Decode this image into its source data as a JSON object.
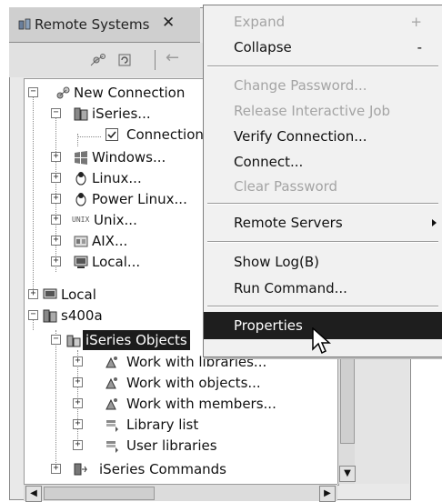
{
  "view": {
    "title": "Remote Systems",
    "close_glyph": "✕"
  },
  "tree": {
    "items": [
      {
        "label": "New Connection",
        "icon": "new-connection-icon",
        "expander": "−"
      },
      {
        "label": "iSeries...",
        "icon": "iseries-icon",
        "expander": "−"
      },
      {
        "label": "Connection",
        "icon": "checkbox-checked-icon",
        "expander": ""
      },
      {
        "label": "Windows...",
        "icon": "windows-icon",
        "expander": "+"
      },
      {
        "label": "Linux...",
        "icon": "linux-icon",
        "expander": "+"
      },
      {
        "label": "Power Linux...",
        "icon": "power-linux-icon",
        "expander": "+"
      },
      {
        "label": "Unix...",
        "icon": "unix-icon",
        "expander": "+"
      },
      {
        "label": "AIX...",
        "icon": "aix-icon",
        "expander": "+"
      },
      {
        "label": "Local...",
        "icon": "local-icon",
        "expander": "+"
      },
      {
        "label": "Local",
        "icon": "local-connection-icon",
        "expander": "+"
      },
      {
        "label": "s400a",
        "icon": "system-icon",
        "expander": "−"
      },
      {
        "label": "iSeries Objects",
        "icon": "iseries-objects-icon",
        "expander": "−"
      },
      {
        "label": "Work with libraries...",
        "icon": "filter-icon",
        "expander": "+"
      },
      {
        "label": "Work with objects...",
        "icon": "filter-icon",
        "expander": "+"
      },
      {
        "label": "Work with members...",
        "icon": "filter-icon",
        "expander": "+"
      },
      {
        "label": "Library list",
        "icon": "library-list-icon",
        "expander": "+"
      },
      {
        "label": "User libraries",
        "icon": "user-libraries-icon",
        "expander": "+"
      },
      {
        "label": "iSeries Commands",
        "icon": "commands-icon",
        "expander": "+"
      }
    ],
    "unix_badge": "UNIX"
  },
  "context_menu": {
    "items": [
      {
        "label": "Expand",
        "accel": "+",
        "enabled": false
      },
      {
        "label": "Collapse",
        "accel": "-",
        "enabled": true
      },
      {
        "label": "Change Password...",
        "enabled": false
      },
      {
        "label": "Release Interactive Job",
        "enabled": false
      },
      {
        "label": "Verify Connection...",
        "enabled": true
      },
      {
        "label": "Connect...",
        "enabled": true
      },
      {
        "label": "Clear Password",
        "enabled": false
      },
      {
        "label": "Remote Servers",
        "enabled": true,
        "submenu": true
      },
      {
        "label": "Show Log(B)",
        "enabled": true
      },
      {
        "label": "Run Command...",
        "enabled": true
      },
      {
        "label": "Properties",
        "enabled": true,
        "highlighted": true
      }
    ]
  },
  "colors": {
    "selection": "#1c1c1c",
    "disabled_text": "#a4a4a4",
    "menu_bg": "#f1f1f1"
  }
}
